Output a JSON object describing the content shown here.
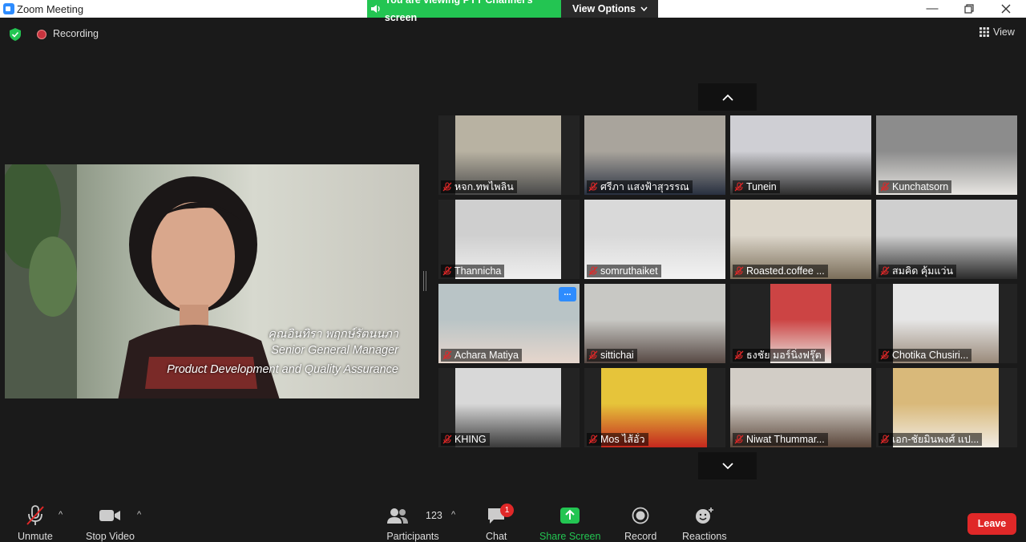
{
  "window": {
    "title": "Zoom Meeting"
  },
  "banner": {
    "viewing_text": "You are viewing PYT Channel's screen",
    "view_options_label": "View Options"
  },
  "status": {
    "recording_label": "Recording",
    "view_label": "View"
  },
  "shared_screen": {
    "caption_lines": [
      "คุณอินทิรา พฤกษ์รัตนนภา",
      "Senior General Manager",
      "Product Development and Quality Assurance"
    ]
  },
  "gallery": {
    "participants": [
      {
        "name": "หจก.ทพไพลิน"
      },
      {
        "name": "ศรีภา แสงฟ้าสุวรรณ"
      },
      {
        "name": "Tunein"
      },
      {
        "name": "Kunchatsorn"
      },
      {
        "name": "Thannicha"
      },
      {
        "name": "somruthaiket"
      },
      {
        "name": "Roasted.coffee ..."
      },
      {
        "name": "สมคิด คุ้มแว่น"
      },
      {
        "name": "Achara Matiya"
      },
      {
        "name": "sittichai"
      },
      {
        "name": "ธงชัย มอร์นิ่งฟรุ๊ต"
      },
      {
        "name": "Chotika Chusiri..."
      },
      {
        "name": "KHING"
      },
      {
        "name": "Mos ไส้อั่ว"
      },
      {
        "name": "Niwat Thummar..."
      },
      {
        "name": "เอก-ชัยมินพงศ์ แป..."
      }
    ],
    "more_button_label": "..."
  },
  "toolbar": {
    "unmute_label": "Unmute",
    "stop_video_label": "Stop Video",
    "participants_label": "Participants",
    "participants_count": "123",
    "chat_label": "Chat",
    "chat_badge": "1",
    "share_screen_label": "Share Screen",
    "record_label": "Record",
    "reactions_label": "Reactions",
    "leave_label": "Leave"
  },
  "colors": {
    "accent": "#2d8cff",
    "share_green": "#23c552",
    "leave_red": "#e02828",
    "mute_red": "#e02828",
    "background": "#1a1a1a"
  }
}
